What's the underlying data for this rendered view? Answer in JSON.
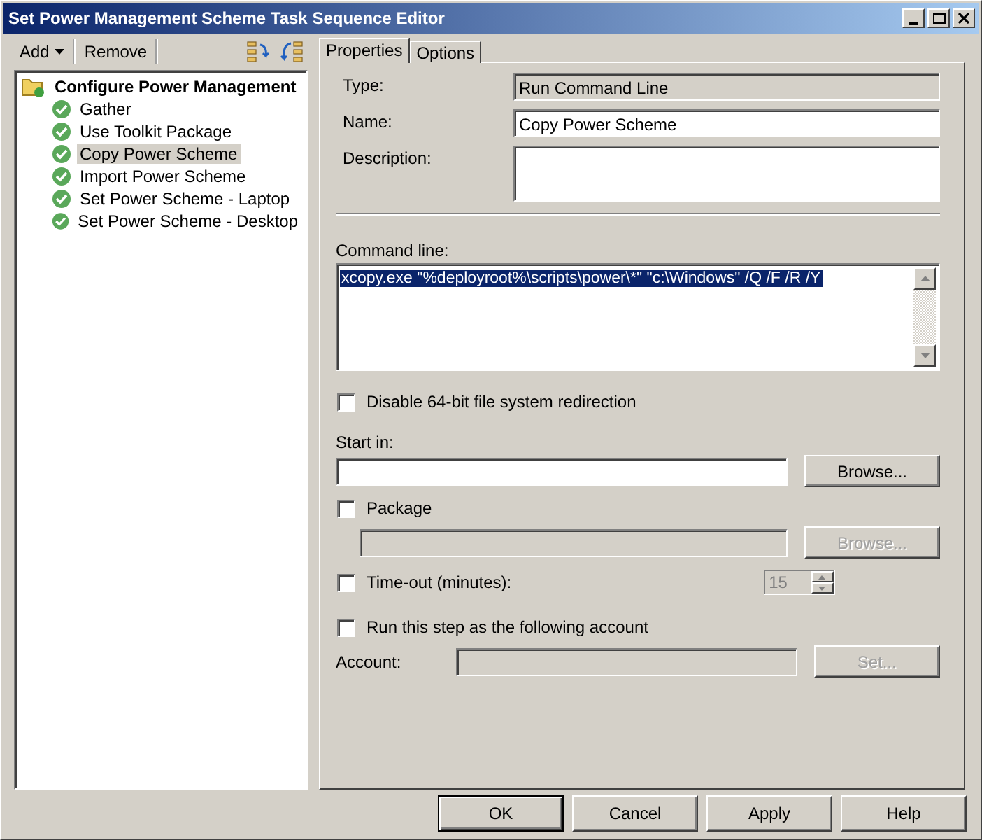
{
  "window": {
    "title": "Set Power Management Scheme Task Sequence Editor"
  },
  "toolbar": {
    "items": [
      {
        "label": "Add",
        "kind": "dropdown"
      },
      {
        "label": "Remove",
        "kind": "button"
      }
    ]
  },
  "tree": {
    "label": "Configure Power Management",
    "expanded": true,
    "children": [
      {
        "label": "Gather",
        "selected": false
      },
      {
        "label": "Use Toolkit Package",
        "selected": false
      },
      {
        "label": "Copy Power Scheme",
        "selected": true
      },
      {
        "label": "Import Power Scheme",
        "selected": false
      },
      {
        "label": "Set Power Scheme - Laptop",
        "selected": false
      },
      {
        "label": "Set Power Scheme - Desktop",
        "selected": false
      }
    ]
  },
  "tabs": [
    {
      "label": "Properties",
      "selected": true
    },
    {
      "label": "Options",
      "selected": false
    }
  ],
  "properties": {
    "type": {
      "label": "Type:",
      "value": "Run Command Line",
      "disabled": true
    },
    "name": {
      "label": "Name:",
      "value": "Copy Power Scheme",
      "disabled": false
    },
    "description": {
      "label": "Description:"
    },
    "command_line": {
      "label": "Command line:",
      "value": "xcopy.exe \"%deployroot%\\scripts\\power\\*\" \"c:\\Windows\" /Q /F /R /Y",
      "value_selected": true
    },
    "disable_redirection": {
      "label": "Disable 64-bit file system redirection",
      "checked": false
    },
    "start_in": {
      "label": "Start in:",
      "disabled": false,
      "button": {
        "label": "Browse...",
        "disabled": false
      }
    },
    "package": {
      "label": "Package",
      "checked": false,
      "disabled": true,
      "button": {
        "label": "Browse...",
        "disabled": true
      }
    },
    "timeout": {
      "label": "Time-out (minutes):",
      "checked": false,
      "value": "15",
      "disabled": true
    },
    "run_as": {
      "label": "Run this step as the following account",
      "checked": false
    },
    "account": {
      "label": "Account:",
      "disabled": true,
      "button": {
        "label": "Set...",
        "disabled": true
      }
    }
  },
  "buttons": [
    {
      "label": "OK",
      "default": true
    },
    {
      "label": "Cancel",
      "default": false
    },
    {
      "label": "Apply",
      "default": false
    },
    {
      "label": "Help",
      "default": false
    }
  ]
}
